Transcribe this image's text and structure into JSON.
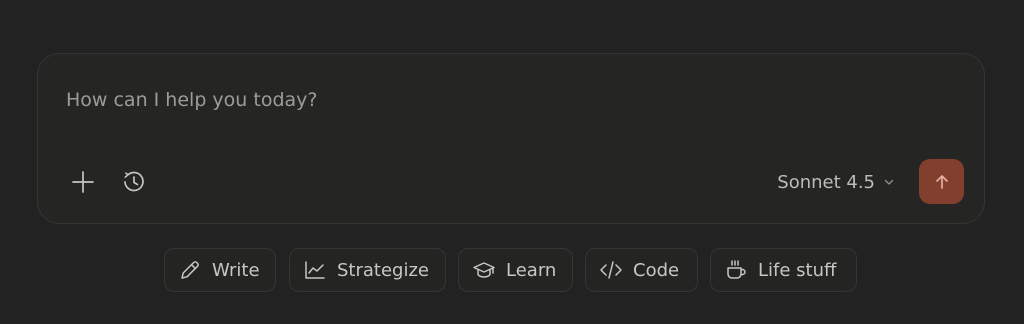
{
  "composer": {
    "placeholder": "How can I help you today?",
    "add_icon": "plus-icon",
    "history_icon": "clock-history-icon",
    "model": {
      "label": "Sonnet 4.5",
      "icon": "chevron-down-icon"
    },
    "send": {
      "icon": "arrow-up-icon",
      "color": "#833f2d"
    }
  },
  "suggestions": [
    {
      "label": "Write",
      "icon": "pencil-icon"
    },
    {
      "label": "Strategize",
      "icon": "line-chart-icon"
    },
    {
      "label": "Learn",
      "icon": "graduation-cap-icon"
    },
    {
      "label": "Code",
      "icon": "code-icon"
    },
    {
      "label": "Life stuff",
      "icon": "coffee-cup-icon"
    }
  ],
  "colors": {
    "background": "#222222",
    "text": "#c8c7c0",
    "placeholder": "#9d9c95",
    "accent": "#833f2d"
  }
}
